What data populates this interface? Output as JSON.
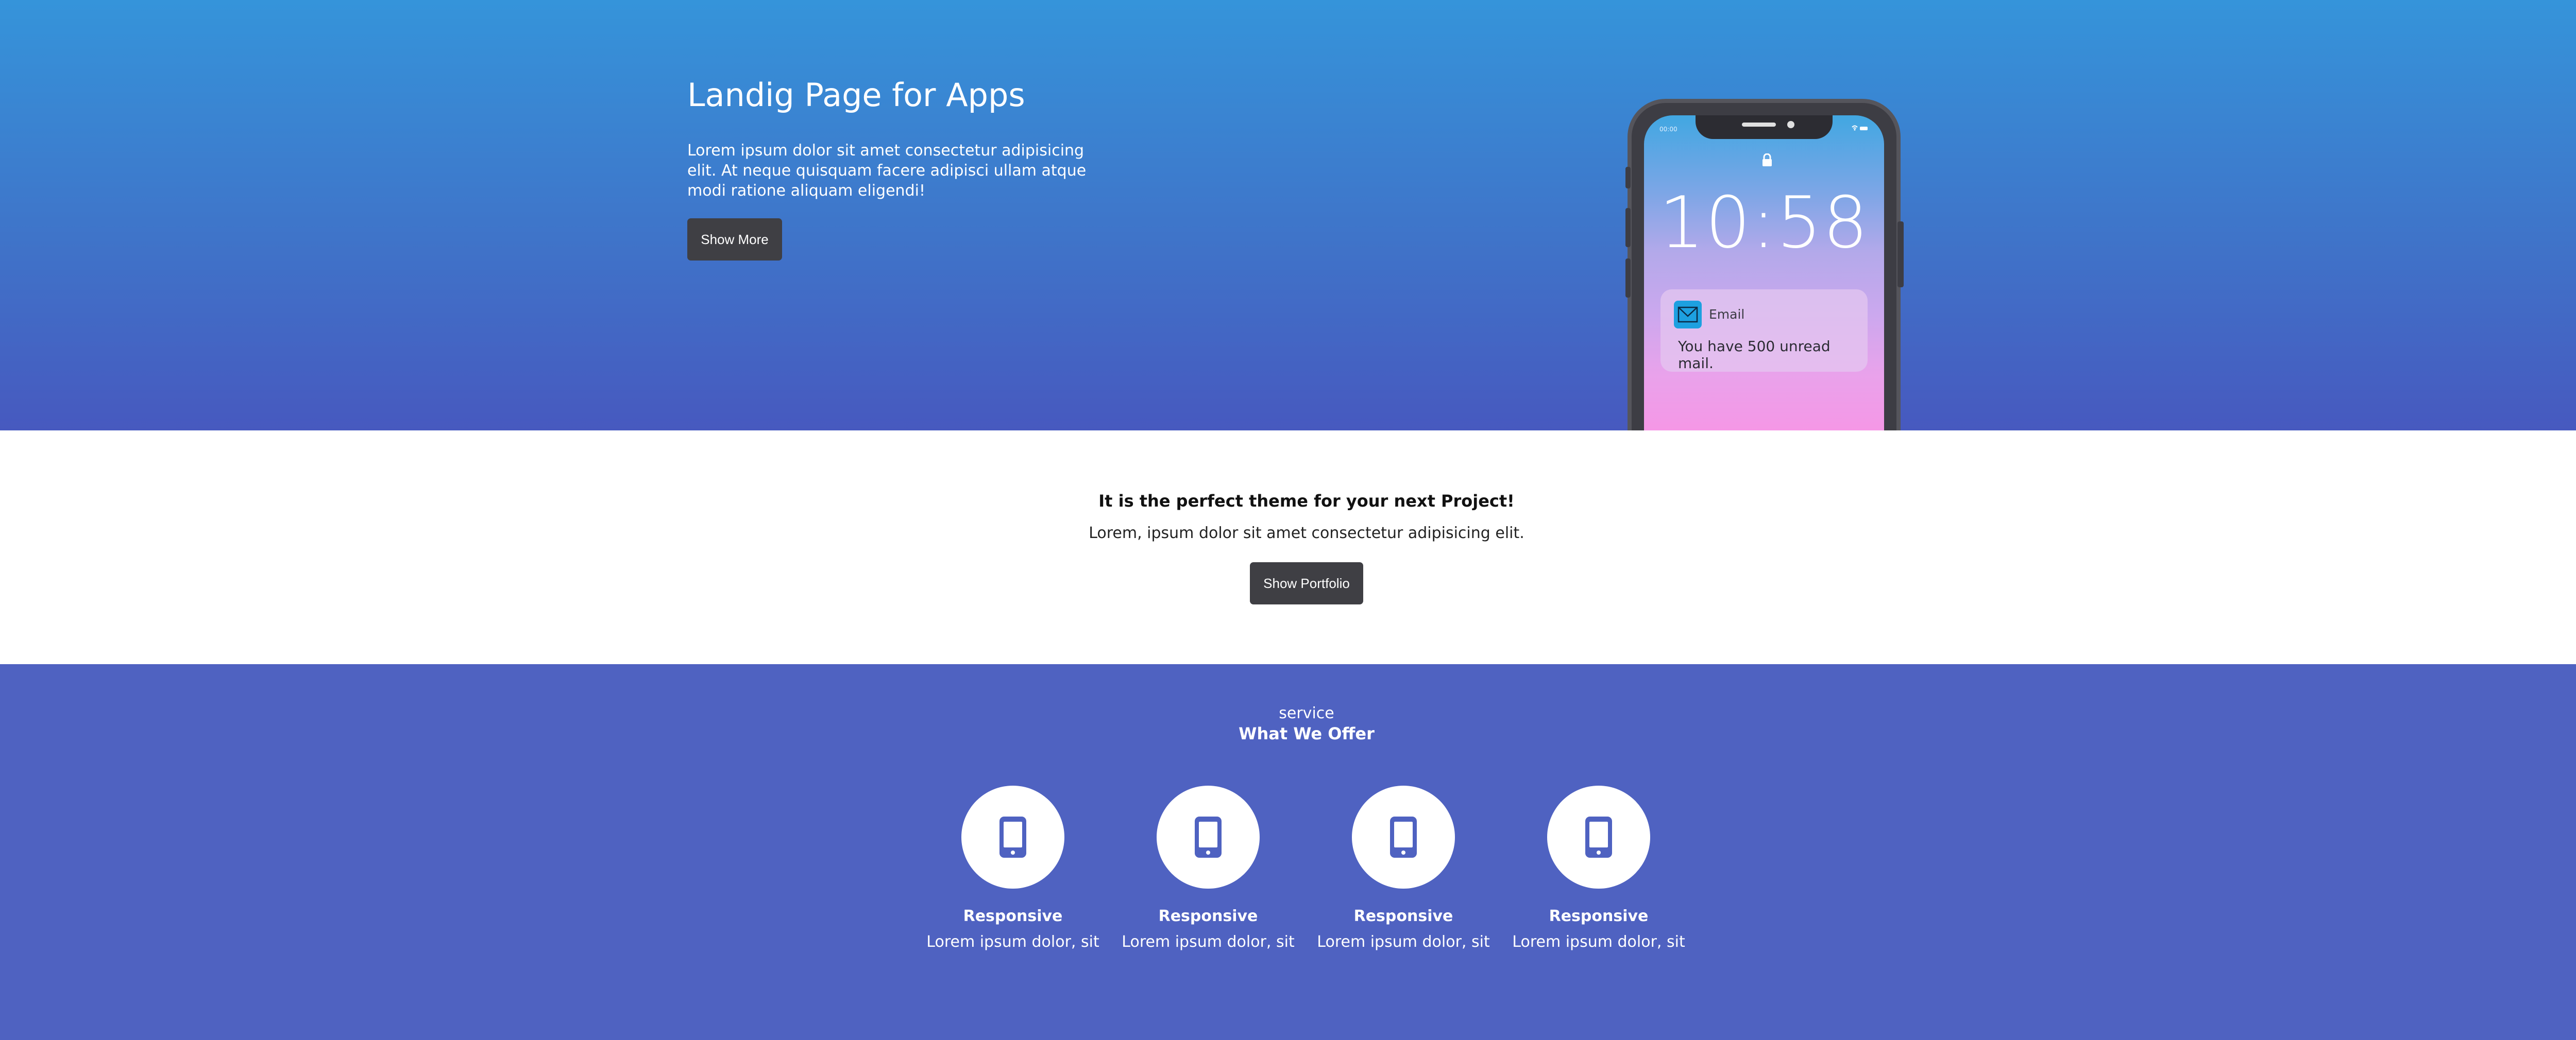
{
  "hero": {
    "title": "Landig Page for Apps",
    "text": "Lorem ipsum dolor sit amet consectetur adipisicing elit. At neque quisquam facere adipisci ullam atque modi ratione aliquam eligendi!",
    "button_label": "Show More"
  },
  "phone": {
    "status_time": "00:00",
    "clock": "10:58",
    "notification": {
      "icon": "mail-icon",
      "app": "Email",
      "message": "You have 500 unread mail."
    }
  },
  "middle": {
    "title": "It is the perfect theme for your next Project!",
    "text": "Lorem, ipsum dolor sit amet consectetur adipisicing elit.",
    "button_label": "Show Portfolio"
  },
  "services": {
    "kicker": "service",
    "title": "What We Offer",
    "items": [
      {
        "icon": "mobile-phone-icon",
        "name": "Responsive",
        "desc": "Lorem ipsum dolor, sit"
      },
      {
        "icon": "mobile-phone-icon",
        "name": "Responsive",
        "desc": "Lorem ipsum dolor, sit"
      },
      {
        "icon": "mobile-phone-icon",
        "name": "Responsive",
        "desc": "Lorem ipsum dolor, sit"
      },
      {
        "icon": "mobile-phone-icon",
        "name": "Responsive",
        "desc": "Lorem ipsum dolor, sit"
      }
    ]
  },
  "colors": {
    "hero_top": "#3594da",
    "hero_bottom": "#4759bf",
    "button_dark": "#3f3f44",
    "services_bg": "#4f62c1"
  }
}
